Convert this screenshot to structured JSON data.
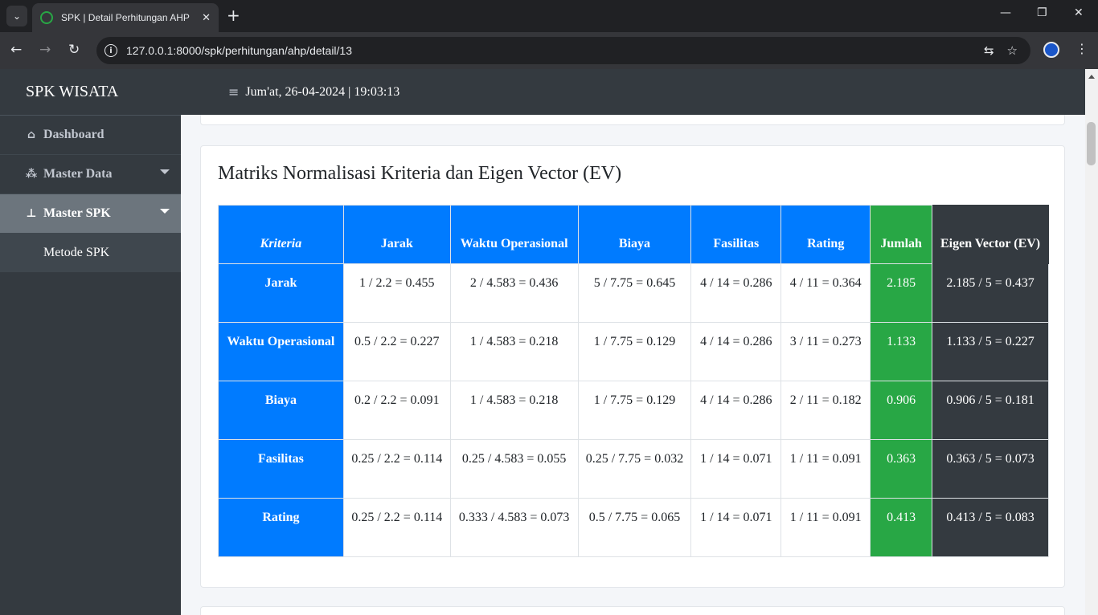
{
  "browser": {
    "tab_title": "SPK | Detail Perhitungan AHP",
    "url": "127.0.0.1:8000/spk/perhitungan/ahp/detail/13"
  },
  "app": {
    "brand": "SPK WISATA",
    "datetime": "Jum'at, 26-04-2024 | 19:03:13"
  },
  "sidebar": {
    "items": [
      {
        "label": "Dashboard",
        "icon": "home-icon"
      },
      {
        "label": "Master Data",
        "icon": "cubes-icon"
      },
      {
        "label": "Master SPK",
        "icon": "sitemap-icon"
      }
    ],
    "sub_items": [
      {
        "label": "Metode SPK"
      }
    ]
  },
  "card": {
    "title": "Matriks Normalisasi Kriteria dan Eigen Vector (EV)"
  },
  "table": {
    "headers": [
      "Kriteria",
      "Jarak",
      "Waktu Operasional",
      "Biaya",
      "Fasilitas",
      "Rating",
      "Jumlah",
      "Eigen Vector (EV)"
    ],
    "rows": [
      {
        "name": "Jarak",
        "cells": [
          "1 / 2.2 = 0.455",
          "2 / 4.583 = 0.436",
          "5 / 7.75 = 0.645",
          "4 / 14 = 0.286",
          "4 / 11 = 0.364"
        ],
        "jumlah": "2.185",
        "ev": "2.185 / 5 = 0.437"
      },
      {
        "name": "Waktu Operasional",
        "cells": [
          "0.5 / 2.2 = 0.227",
          "1 / 4.583 = 0.218",
          "1 / 7.75 = 0.129",
          "4 / 14 = 0.286",
          "3 / 11 = 0.273"
        ],
        "jumlah": "1.133",
        "ev": "1.133 / 5 = 0.227"
      },
      {
        "name": "Biaya",
        "cells": [
          "0.2 / 2.2 = 0.091",
          "1 / 4.583 = 0.218",
          "1 / 7.75 = 0.129",
          "4 / 14 = 0.286",
          "2 / 11 = 0.182"
        ],
        "jumlah": "0.906",
        "ev": "0.906 / 5 = 0.181"
      },
      {
        "name": "Fasilitas",
        "cells": [
          "0.25 / 2.2 = 0.114",
          "0.25 / 4.583 = 0.055",
          "0.25 / 7.75 = 0.032",
          "1 / 14 = 0.071",
          "1 / 11 = 0.091"
        ],
        "jumlah": "0.363",
        "ev": "0.363 / 5 = 0.073"
      },
      {
        "name": "Rating",
        "cells": [
          "0.25 / 2.2 = 0.114",
          "0.333 / 4.583 = 0.073",
          "0.5 / 7.75 = 0.065",
          "1 / 14 = 0.071",
          "1 / 11 = 0.091"
        ],
        "jumlah": "0.413",
        "ev": "0.413 / 5 = 0.083"
      }
    ]
  },
  "colors": {
    "primary": "#007bff",
    "success": "#28a745",
    "dark": "#343a40"
  }
}
